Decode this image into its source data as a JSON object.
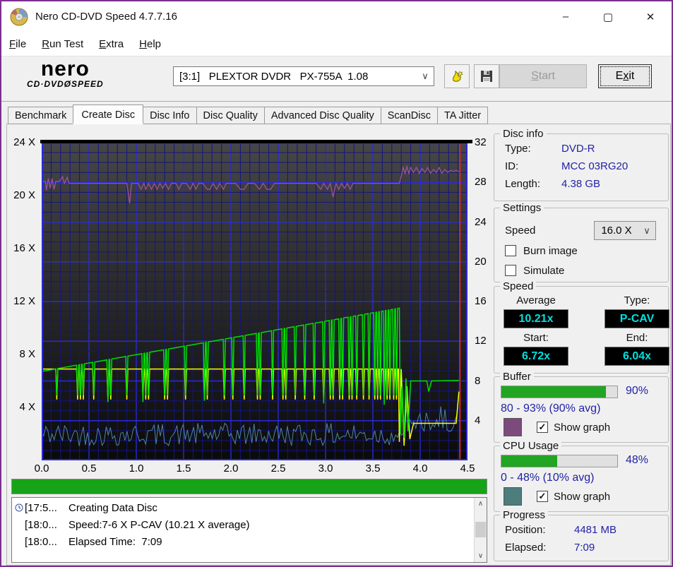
{
  "window": {
    "title": "Nero CD-DVD Speed 4.7.7.16",
    "minimize": "–",
    "maximize": "▢",
    "close": "✕"
  },
  "menu": {
    "items": [
      {
        "label": "File",
        "accel": "F"
      },
      {
        "label": "Run Test",
        "accel": "R"
      },
      {
        "label": "Extra",
        "accel": "E"
      },
      {
        "label": "Help",
        "accel": "H"
      }
    ]
  },
  "toolbar": {
    "logo_line1": "nero",
    "logo_line2": "CD·DVDØSPEED",
    "drive_select_value": "[3:1]   PLEXTOR DVDR   PX-755A  1.08",
    "combo_chevron": "∨",
    "start_label": "Start",
    "start_accel": "S",
    "exit_label": "Exit",
    "exit_accel": "x"
  },
  "tabs": {
    "items": [
      "Benchmark",
      "Create Disc",
      "Disc Info",
      "Disc Quality",
      "Advanced Disc Quality",
      "ScanDisc",
      "TA Jitter"
    ],
    "active_index": 1
  },
  "disc_info": {
    "title": "Disc info",
    "type_label": "Type:",
    "type_value": "DVD-R",
    "id_label": "ID:",
    "id_value": "MCC 03RG20",
    "length_label": "Length:",
    "length_value": "4.38 GB"
  },
  "settings": {
    "title": "Settings",
    "speed_label": "Speed",
    "speed_value": "16.0 X",
    "burn_image_label": "Burn image",
    "burn_image_checked": false,
    "simulate_label": "Simulate",
    "simulate_checked": false
  },
  "speed": {
    "title": "Speed",
    "average_label": "Average",
    "average_value": "10.21x",
    "type_label": "Type:",
    "type_value": "P-CAV",
    "start_label": "Start:",
    "start_value": "6.72x",
    "end_label": "End:",
    "end_value": "6.04x"
  },
  "buffer": {
    "title": "Buffer",
    "percent": 90,
    "percent_label": "90%",
    "range_text": "80 - 93% (90% avg)",
    "swatch_color": "#7d4a7d",
    "show_graph_label": "Show graph",
    "show_graph_checked": true
  },
  "cpu": {
    "title": "CPU Usage",
    "percent": 48,
    "percent_label": "48%",
    "range_text": "0 - 48% (10% avg)",
    "swatch_color": "#4d7d7d",
    "show_graph_label": "Show graph",
    "show_graph_checked": true
  },
  "progress_section": {
    "title": "Progress",
    "position_label": "Position:",
    "position_value": "4481 MB",
    "elapsed_label": "Elapsed:",
    "elapsed_value": "7:09",
    "bar_percent": 100
  },
  "log": {
    "rows": [
      {
        "time": "[17:5...",
        "text": "Creating Data Disc",
        "icon": true
      },
      {
        "time": "[18:0...",
        "text": "Speed:7-6 X P-CAV (10.21 X average)",
        "icon": false
      },
      {
        "time": "[18:0...",
        "text": "Elapsed Time:  7:09",
        "icon": false
      }
    ]
  },
  "chart_data": {
    "type": "line",
    "title": "",
    "x_axis": {
      "min": 0,
      "max": 4.5,
      "major_step": 0.5,
      "minor_step": 0.1,
      "tick_labels": [
        "0.0",
        "0.5",
        "1.0",
        "1.5",
        "2.0",
        "2.5",
        "3.0",
        "3.5",
        "4.0",
        "4.5"
      ]
    },
    "left_axis": {
      "min": 0,
      "max": 24,
      "tick_values": [
        24,
        20,
        16,
        12,
        8,
        4
      ],
      "tick_labels": [
        "24 X",
        "20 X",
        "16 X",
        "12 X",
        "8 X",
        "4 X"
      ]
    },
    "right_axis": {
      "min": 0,
      "max": 32,
      "major_step": 4,
      "minor_step": 1,
      "tick_values": [
        32,
        28,
        24,
        20,
        16,
        12,
        8,
        4
      ]
    },
    "grid": {
      "major_color": "#2a2ad8",
      "minor_color": "#15157e",
      "bg_top": "#464646",
      "bg_bottom": "#0a0a0a"
    },
    "position_marker": {
      "x": 4.42,
      "color": "#d42a2a"
    },
    "series": [
      {
        "name": "cpu-usage-graph",
        "color": "#4f84a0",
        "width": 1,
        "axis": "right",
        "parts": [
          {
            "kind": "noise",
            "x0": 0,
            "x1": 3.8,
            "step": 0.022,
            "base": 2.6,
            "amp": 1.15,
            "seed": 42,
            "min": 1.1
          },
          {
            "kind": "noise",
            "x0": 3.8,
            "x1": 4.41,
            "step": 0.022,
            "base": 4.0,
            "amp": 1.5,
            "seed": 7,
            "min": 1.6
          }
        ]
      },
      {
        "name": "secondary-speed-graph",
        "color": "#ffff00",
        "width": 1.5,
        "axis": "left",
        "parts": [
          {
            "kind": "ramp_spikes",
            "x0": 0,
            "y0": 6.9,
            "x1": 3.77,
            "y1": 6.9,
            "spike_y": 4.6,
            "half_width": 0.011,
            "spikes": [
              0.16,
              0.38,
              0.41,
              0.44,
              0.55,
              0.7,
              0.73,
              0.9,
              1.07,
              1.1,
              1.13,
              1.3,
              1.33,
              1.52,
              1.72,
              1.75,
              1.93,
              2.02,
              2.14,
              2.28,
              2.31,
              2.44,
              2.55,
              2.58,
              2.68,
              2.78,
              2.88,
              2.98,
              3.05,
              3.08,
              3.15,
              3.18,
              3.25,
              3.28,
              3.33,
              3.4,
              3.46,
              3.52,
              3.55,
              3.58,
              3.62,
              3.65,
              3.68,
              3.72,
              3.75
            ]
          },
          {
            "kind": "points",
            "pts": [
              [
                3.78,
                1.4
              ],
              [
                3.8,
                6.9
              ],
              [
                3.83,
                1.1
              ],
              [
                3.86,
                5.6
              ],
              [
                3.89,
                1.6
              ],
              [
                3.93,
                2.8
              ],
              [
                4.38,
                2.8
              ],
              [
                4.41,
                5.2
              ]
            ]
          }
        ]
      },
      {
        "name": "write-speed-graph",
        "color": "#00dc00",
        "width": 1.5,
        "axis": "left",
        "parts": [
          {
            "kind": "ramp_spikes",
            "x0": 0,
            "y0": 6.72,
            "x1": 3.78,
            "y1": 11.5,
            "spike_y": 4.9,
            "half_width": 0.011,
            "spikes": [
              0.16,
              0.38,
              0.41,
              0.44,
              0.55,
              [
                0.7,
                4.4
              ],
              0.73,
              0.9,
              [
                1.07,
                4.4
              ],
              1.1,
              1.13,
              1.3,
              1.33,
              1.52,
              [
                1.72,
                4.5
              ],
              1.75,
              1.93,
              2.02,
              2.14,
              2.28,
              2.31,
              2.44,
              2.55,
              2.58,
              2.68,
              2.78,
              2.88,
              [
                2.98,
                4.3
              ],
              3.05,
              3.08,
              3.15,
              3.18,
              3.25,
              3.28,
              3.33,
              3.4,
              3.46,
              3.52,
              3.55,
              3.58,
              [
                3.62,
                4.2
              ],
              3.65,
              3.68,
              3.72,
              3.75
            ]
          },
          {
            "kind": "points",
            "pts": [
              [
                3.79,
                2.0
              ],
              [
                3.81,
                5.6
              ],
              [
                3.83,
                1.7
              ],
              [
                3.85,
                6.2
              ],
              [
                3.87,
                2.2
              ],
              [
                3.9,
                6.0
              ],
              [
                4.07,
                6.0
              ],
              [
                4.09,
                5.2
              ],
              [
                4.12,
                6.0
              ],
              [
                4.41,
                6.04
              ]
            ]
          }
        ]
      },
      {
        "name": "buffer-graph",
        "color": "#a055a0",
        "width": 1.2,
        "axis": "right",
        "parts": [
          {
            "kind": "points",
            "pts": [
              [
                0,
                28.1
              ],
              [
                0.04,
                28.1
              ],
              [
                0.05,
                27.2
              ],
              [
                0.07,
                28.4
              ],
              [
                0.09,
                27.4
              ],
              [
                0.11,
                28.4
              ],
              [
                0.13,
                27.3
              ],
              [
                0.15,
                28.1
              ],
              [
                0.19,
                28.1
              ],
              [
                0.22,
                28.6
              ],
              [
                0.24,
                27.9
              ],
              [
                0.27,
                28.5
              ],
              [
                0.29,
                27.9
              ],
              [
                0.33,
                27.9
              ],
              [
                0.37,
                27.9
              ],
              [
                0.42,
                27.9
              ],
              [
                0.48,
                27.9
              ],
              [
                0.55,
                27.9
              ],
              [
                0.62,
                27.9
              ],
              [
                0.7,
                27.9
              ],
              [
                0.78,
                27.9
              ],
              [
                0.85,
                27.9
              ],
              [
                0.9,
                27.9
              ],
              [
                0.93,
                25.9
              ],
              [
                0.95,
                27.9
              ],
              [
                1.02,
                27.9
              ],
              [
                1.05,
                27.3
              ],
              [
                1.08,
                27.9
              ],
              [
                1.1,
                27.3
              ],
              [
                1.13,
                27.9
              ],
              [
                1.16,
                27.3
              ],
              [
                1.19,
                27.9
              ],
              [
                1.22,
                27.3
              ],
              [
                1.25,
                27.9
              ],
              [
                1.28,
                27.4
              ],
              [
                1.31,
                27.9
              ],
              [
                1.34,
                27.3
              ],
              [
                1.37,
                27.9
              ],
              [
                1.42,
                27.9
              ],
              [
                1.45,
                27.3
              ],
              [
                1.48,
                27.9
              ],
              [
                1.53,
                27.9
              ],
              [
                1.57,
                27.3
              ],
              [
                1.6,
                27.9
              ],
              [
                1.63,
                27.3
              ],
              [
                1.66,
                27.9
              ],
              [
                1.7,
                27.9
              ],
              [
                1.75,
                27.3
              ],
              [
                1.78,
                27.3
              ],
              [
                1.81,
                27.9
              ],
              [
                1.85,
                27.3
              ],
              [
                1.88,
                27.9
              ],
              [
                1.92,
                27.3
              ],
              [
                1.95,
                27.9
              ],
              [
                2.0,
                27.9
              ],
              [
                2.05,
                27.9
              ],
              [
                2.1,
                27.3
              ],
              [
                2.14,
                27.3
              ],
              [
                2.18,
                27.9
              ],
              [
                2.25,
                27.9
              ],
              [
                2.3,
                27.3
              ],
              [
                2.34,
                27.9
              ],
              [
                2.38,
                27.3
              ],
              [
                2.42,
                27.3
              ],
              [
                2.46,
                27.9
              ],
              [
                2.52,
                27.9
              ],
              [
                2.6,
                27.9
              ],
              [
                2.7,
                27.9
              ],
              [
                2.8,
                27.9
              ],
              [
                2.9,
                27.9
              ],
              [
                2.95,
                27.3
              ],
              [
                2.98,
                27.9
              ],
              [
                3.02,
                27.3
              ],
              [
                3.05,
                27.9
              ],
              [
                3.08,
                26.5
              ],
              [
                3.11,
                27.9
              ],
              [
                3.14,
                27.3
              ],
              [
                3.17,
                27.9
              ],
              [
                3.2,
                27.4
              ],
              [
                3.23,
                27.9
              ],
              [
                3.26,
                27.3
              ],
              [
                3.29,
                27.9
              ],
              [
                3.33,
                27.9
              ],
              [
                3.4,
                27.9
              ],
              [
                3.48,
                27.9
              ],
              [
                3.56,
                27.9
              ],
              [
                3.64,
                27.9
              ],
              [
                3.72,
                27.9
              ],
              [
                3.78,
                27.9
              ],
              [
                3.8,
                28.6
              ],
              [
                3.82,
                29.5
              ],
              [
                3.84,
                28.9
              ],
              [
                3.86,
                29.6
              ],
              [
                3.88,
                28.9
              ],
              [
                3.9,
                29.5
              ],
              [
                3.93,
                29.0
              ],
              [
                3.96,
                29.5
              ],
              [
                3.99,
                28.9
              ],
              [
                4.02,
                29.4
              ],
              [
                4.05,
                29.0
              ],
              [
                4.08,
                29.5
              ],
              [
                4.11,
                28.9
              ],
              [
                4.14,
                29.3
              ],
              [
                4.17,
                29.0
              ],
              [
                4.2,
                29.5
              ],
              [
                4.23,
                28.9
              ],
              [
                4.26,
                29.3
              ],
              [
                4.29,
                29.0
              ],
              [
                4.32,
                29.2
              ],
              [
                4.35,
                29.1
              ],
              [
                4.38,
                29.2
              ],
              [
                4.41,
                29.1
              ]
            ]
          }
        ]
      }
    ]
  }
}
